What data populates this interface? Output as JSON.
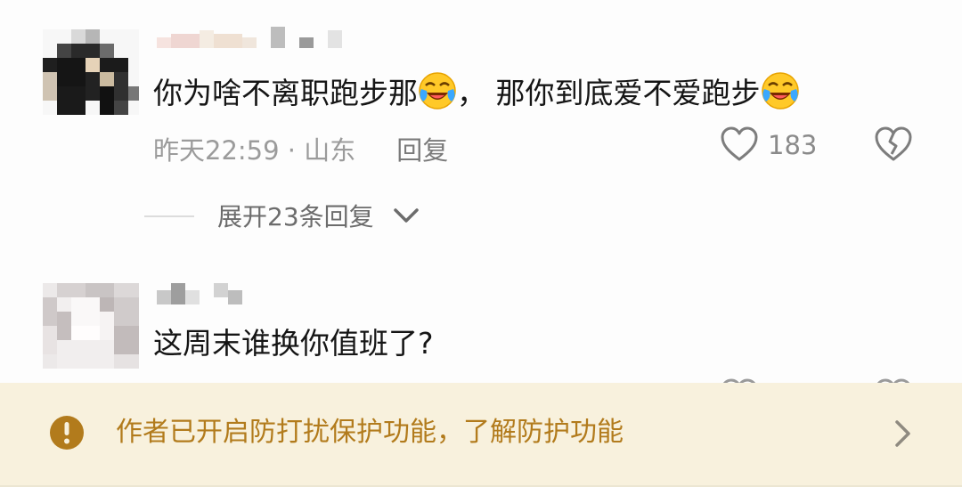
{
  "comments": [
    {
      "username": "",
      "content": "你为啥不离职跑步那",
      "content_emoji": "laugh-cry-emoji",
      "content2": "， 那你到底爱不爱跑步",
      "content2_emoji": "laugh-cry-emoji",
      "time_location": "昨天22:59 · 山东",
      "reply_label": "回复",
      "like_count": "183"
    },
    {
      "username": "",
      "content": "这周末谁换你值班了?"
    }
  ],
  "expand_replies": "展开23条回复",
  "notice": {
    "text": "作者已开启防打扰保护功能，了解防护功能",
    "icon": "exclamation-circle-icon",
    "color": "#b27b1c"
  }
}
